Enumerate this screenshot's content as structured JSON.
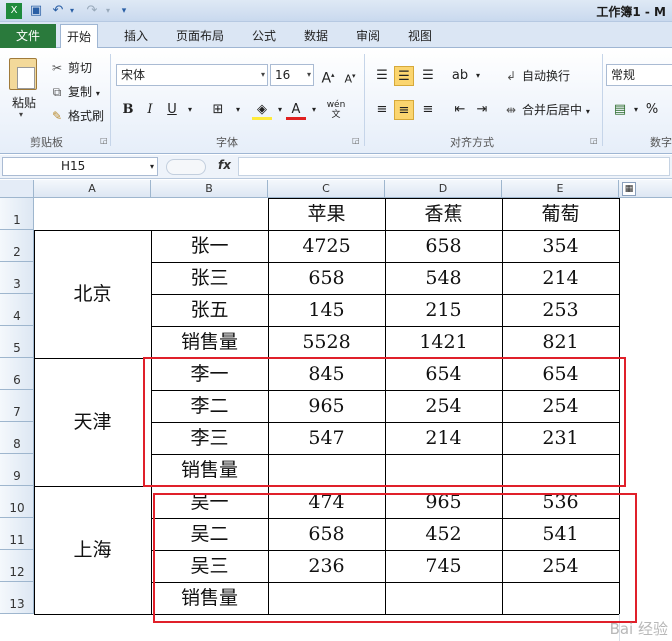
{
  "window": {
    "title": "工作簿1 - M"
  },
  "ribbon_tabs": {
    "file": "文件",
    "home": "开始",
    "insert": "插入",
    "page_layout": "页面布局",
    "formulas": "公式",
    "data": "数据",
    "review": "审阅",
    "view": "视图"
  },
  "clipboard": {
    "paste": "粘贴",
    "cut": "剪切",
    "copy": "复制",
    "format_painter": "格式刷",
    "group_label": "剪贴板"
  },
  "font": {
    "name": "宋体",
    "size": "16",
    "bold": "B",
    "italic": "I",
    "underline": "U",
    "group_label": "字体"
  },
  "alignment": {
    "wrap_text": "自动换行",
    "merge_center": "合并后居中",
    "group_label": "对齐方式"
  },
  "number": {
    "format": "常规",
    "percent": "%",
    "group_label": "数字"
  },
  "formula_bar": {
    "name_box": "H15",
    "fx": "fx",
    "formula": ""
  },
  "sheet": {
    "col_headers": [
      "A",
      "B",
      "C",
      "D",
      "E"
    ],
    "row_headers": [
      "1",
      "2",
      "3",
      "4",
      "5",
      "6",
      "7",
      "8",
      "9",
      "10",
      "11",
      "12",
      "13"
    ],
    "header_row": [
      "苹果",
      "香蕉",
      "葡萄"
    ],
    "cities": [
      "北京",
      "天津",
      "上海"
    ],
    "rows": [
      {
        "name": "张一",
        "apple": "4725",
        "banana": "658",
        "grape": "354"
      },
      {
        "name": "张三",
        "apple": "658",
        "banana": "548",
        "grape": "214"
      },
      {
        "name": "张五",
        "apple": "145",
        "banana": "215",
        "grape": "253"
      },
      {
        "name": "销售量",
        "apple": "5528",
        "banana": "1421",
        "grape": "821"
      },
      {
        "name": "李一",
        "apple": "845",
        "banana": "654",
        "grape": "654"
      },
      {
        "name": "李二",
        "apple": "965",
        "banana": "254",
        "grape": "254"
      },
      {
        "name": "李三",
        "apple": "547",
        "banana": "214",
        "grape": "231"
      },
      {
        "name": "销售量",
        "apple": "",
        "banana": "",
        "grape": ""
      },
      {
        "name": "吴一",
        "apple": "474",
        "banana": "965",
        "grape": "536"
      },
      {
        "name": "吴二",
        "apple": "658",
        "banana": "452",
        "grape": "541"
      },
      {
        "name": "吴三",
        "apple": "236",
        "banana": "745",
        "grape": "254"
      },
      {
        "name": "销售量",
        "apple": "",
        "banana": "",
        "grape": ""
      }
    ]
  },
  "watermark": "Bai 经验",
  "colors": {
    "highlight_box": "#e0202a",
    "file_tab": "#2a7a3c"
  }
}
